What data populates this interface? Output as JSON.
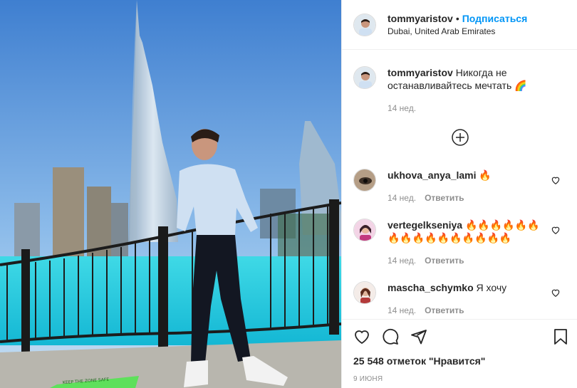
{
  "header": {
    "username": "tommyaristov",
    "separator": "•",
    "follow_label": "Подписаться",
    "location": "Dubai, United Arab Emirates"
  },
  "caption": {
    "username": "tommyaristov",
    "text": "Никогда не останавливайтесь мечтать 🌈",
    "time": "14 нед."
  },
  "comments": [
    {
      "username": "ukhova_anya_lami",
      "text": "🔥",
      "time": "14 нед.",
      "reply_label": "Ответить"
    },
    {
      "username": "vertegelkseniya",
      "text": "🔥🔥🔥🔥🔥🔥🔥🔥🔥🔥🔥🔥🔥🔥🔥🔥",
      "time": "14 нед.",
      "reply_label": "Ответить"
    },
    {
      "username": "mascha_schymko",
      "text": "Я хочу",
      "time": "14 нед.",
      "reply_label": "Ответить"
    }
  ],
  "actions": {
    "likes_text": "25 548 отметок \"Нравится\"",
    "date": "9 ИЮНЯ"
  },
  "photo": {
    "sign_text": "KEEP THE ZONE SAFE"
  },
  "colors": {
    "link": "#0095f6",
    "text": "#262626",
    "secondary": "#8e8e8e",
    "border": "#efefef"
  }
}
